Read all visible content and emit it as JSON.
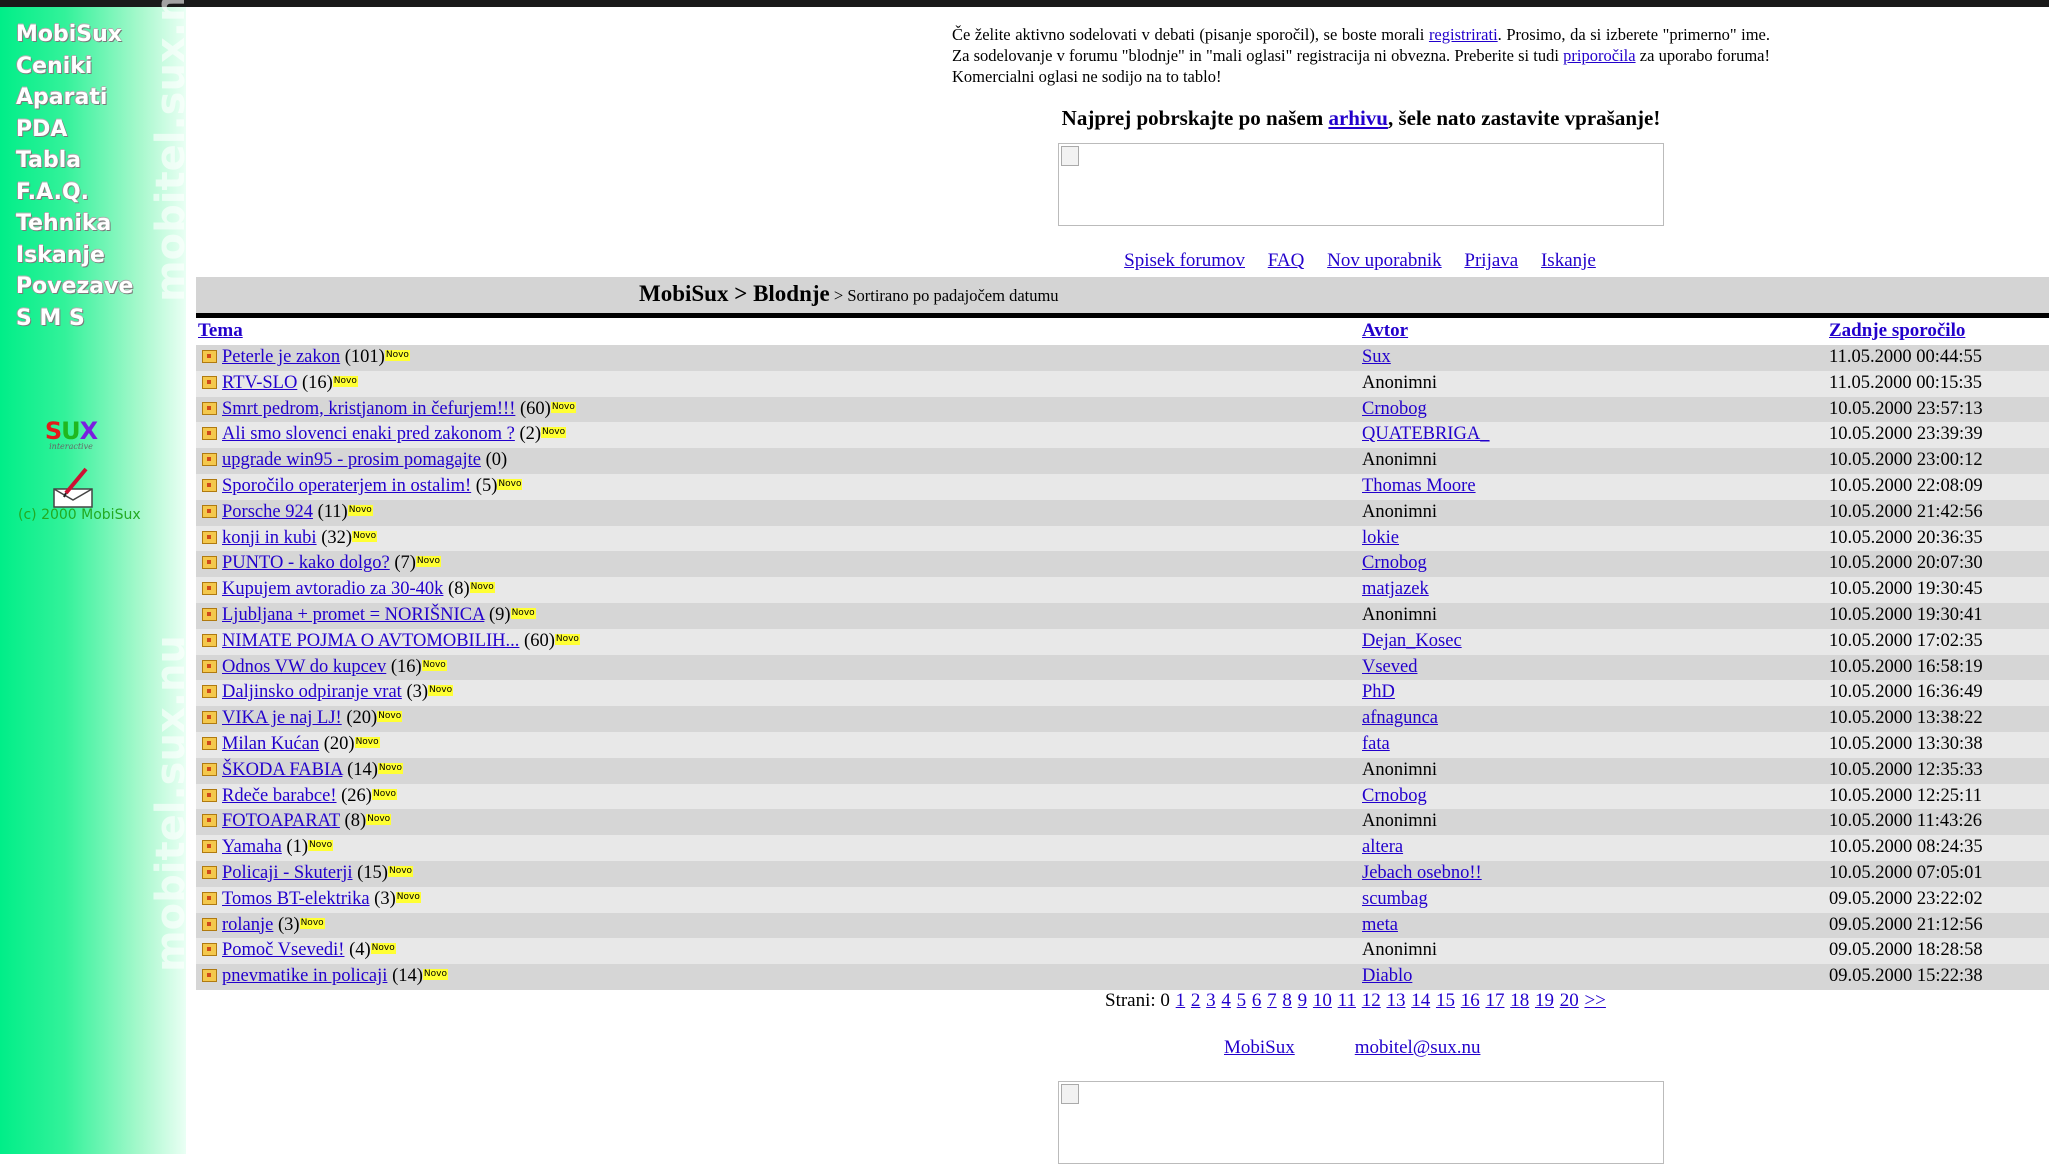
{
  "sidebar": {
    "nav": [
      "MobiSux",
      "Ceniki",
      "Aparati",
      "PDA",
      "Tabla",
      "F.A.Q.",
      "Tehnika",
      "Iskanje",
      "Povezave",
      "S M S"
    ],
    "watermark": "mobitel.sux.nu",
    "logo_text": "SUX",
    "logo_sub": "interactive",
    "copyright": "(c) 2000 MobiSux"
  },
  "intro": {
    "text_1": "Če želite aktivno sodelovati v debati (pisanje sporočil), se boste morali ",
    "register_link": "registrirati",
    "text_2": ". Prosimo, da si izberete \"primerno\" ime. Za sodelovanje v forumu \"blodnje\" in \"mali oglasi\" registracija ni obvezna. Preberite si tudi ",
    "recommendations_link": "priporočila",
    "text_3": " za uporabo foruma! Komercialni oglasi ne sodijo na to tablo!"
  },
  "archive": {
    "text_1": "Najprej pobrskajte po našem ",
    "link": "arhivu",
    "text_2": ", šele nato zastavite vprašanje!"
  },
  "forum_links": [
    "Spisek forumov",
    "FAQ",
    "Nov uporabnik",
    "Prijava",
    "Iskanje"
  ],
  "breadcrumb": {
    "path": "MobiSux > Blodnje",
    "sort": " > Sortirano po padajočem datumu"
  },
  "table": {
    "headers": {
      "topic": "Tema",
      "author": "Avtor",
      "last": "Zadnje sporočilo"
    },
    "novo_label": "Novo",
    "rows": [
      {
        "topic": "Peterle je zakon",
        "count": "(101)",
        "novo": true,
        "author": "Sux",
        "author_link": true,
        "date": "11.05.2000 00:44:55"
      },
      {
        "topic": "RTV-SLO",
        "count": "(16)",
        "novo": true,
        "author": "Anonimni",
        "author_link": false,
        "date": "11.05.2000 00:15:35"
      },
      {
        "topic": "Smrt pedrom, kristjanom in čefurjem!!!",
        "count": "(60)",
        "novo": true,
        "author": "Crnobog",
        "author_link": true,
        "date": "10.05.2000 23:57:13"
      },
      {
        "topic": "Ali smo slovenci enaki pred zakonom ?",
        "count": "(2)",
        "novo": true,
        "author": "QUATEBRIGA_",
        "author_link": true,
        "date": "10.05.2000 23:39:39"
      },
      {
        "topic": "upgrade win95 - prosim pomagajte",
        "count": "(0)",
        "novo": false,
        "author": "Anonimni",
        "author_link": false,
        "date": "10.05.2000 23:00:12"
      },
      {
        "topic": "Sporočilo operaterjem in ostalim!",
        "count": "(5)",
        "novo": true,
        "author": "Thomas Moore",
        "author_link": true,
        "date": "10.05.2000 22:08:09"
      },
      {
        "topic": "Porsche 924",
        "count": "(11)",
        "novo": true,
        "author": "Anonimni",
        "author_link": false,
        "date": "10.05.2000 21:42:56"
      },
      {
        "topic": "konji in kubi",
        "count": "(32)",
        "novo": true,
        "author": "lokie",
        "author_link": true,
        "date": "10.05.2000 20:36:35"
      },
      {
        "topic": "PUNTO - kako dolgo?",
        "count": "(7)",
        "novo": true,
        "author": "Crnobog",
        "author_link": true,
        "date": "10.05.2000 20:07:30"
      },
      {
        "topic": "Kupujem avtoradio za 30-40k",
        "count": "(8)",
        "novo": true,
        "author": "matjazek",
        "author_link": true,
        "date": "10.05.2000 19:30:45"
      },
      {
        "topic": "Ljubljana + promet = NORIŠNICA",
        "count": "(9)",
        "novo": true,
        "author": "Anonimni",
        "author_link": false,
        "date": "10.05.2000 19:30:41"
      },
      {
        "topic": "NIMATE POJMA O AVTOMOBILIH...",
        "count": "(60)",
        "novo": true,
        "author": "Dejan_Kosec",
        "author_link": true,
        "date": "10.05.2000 17:02:35"
      },
      {
        "topic": "Odnos VW do kupcev",
        "count": "(16)",
        "novo": true,
        "author": "Vseved",
        "author_link": true,
        "date": "10.05.2000 16:58:19"
      },
      {
        "topic": "Daljinsko odpiranje vrat",
        "count": "(3)",
        "novo": true,
        "author": "PhD",
        "author_link": true,
        "date": "10.05.2000 16:36:49"
      },
      {
        "topic": "VIKA je naj LJ!",
        "count": "(20)",
        "novo": true,
        "author": "afnagunca",
        "author_link": true,
        "date": "10.05.2000 13:38:22"
      },
      {
        "topic": "Milan Kućan",
        "count": "(20)",
        "novo": true,
        "author": "fata",
        "author_link": true,
        "date": "10.05.2000 13:30:38"
      },
      {
        "topic": "ŠKODA FABIA",
        "count": "(14)",
        "novo": true,
        "author": "Anonimni",
        "author_link": false,
        "date": "10.05.2000 12:35:33"
      },
      {
        "topic": "Rdeče barabce!",
        "count": "(26)",
        "novo": true,
        "author": "Crnobog",
        "author_link": true,
        "date": "10.05.2000 12:25:11"
      },
      {
        "topic": "FOTOAPARAT",
        "count": "(8)",
        "novo": true,
        "author": "Anonimni",
        "author_link": false,
        "date": "10.05.2000 11:43:26"
      },
      {
        "topic": "Yamaha",
        "count": "(1)",
        "novo": true,
        "author": "altera",
        "author_link": true,
        "date": "10.05.2000 08:24:35"
      },
      {
        "topic": "Policaji - Skuterji",
        "count": "(15)",
        "novo": true,
        "author": "Jebach osebno!!",
        "author_link": true,
        "date": "10.05.2000 07:05:01"
      },
      {
        "topic": "Tomos BT-elektrika",
        "count": "(3)",
        "novo": true,
        "author": "scumbag",
        "author_link": true,
        "date": "09.05.2000 23:22:02"
      },
      {
        "topic": "rolanje",
        "count": "(3)",
        "novo": true,
        "author": "meta",
        "author_link": true,
        "date": "09.05.2000 21:12:56"
      },
      {
        "topic": "Pomoč Vsevedi!",
        "count": "(4)",
        "novo": true,
        "author": "Anonimni",
        "author_link": false,
        "date": "09.05.2000 18:28:58"
      },
      {
        "topic": "pnevmatike in policaji",
        "count": "(14)",
        "novo": true,
        "author": "Diablo",
        "author_link": true,
        "date": "09.05.2000 15:22:38"
      }
    ]
  },
  "pager": {
    "label": "Strani: 0",
    "pages": [
      "1",
      "2",
      "3",
      "4",
      "5",
      "6",
      "7",
      "8",
      "9",
      "10",
      "11",
      "12",
      "13",
      "14",
      "15",
      "16",
      "17",
      "18",
      "19",
      "20"
    ],
    "next": ">>"
  },
  "footer": {
    "home": "MobiSux",
    "email": "mobitel@sux.nu"
  }
}
